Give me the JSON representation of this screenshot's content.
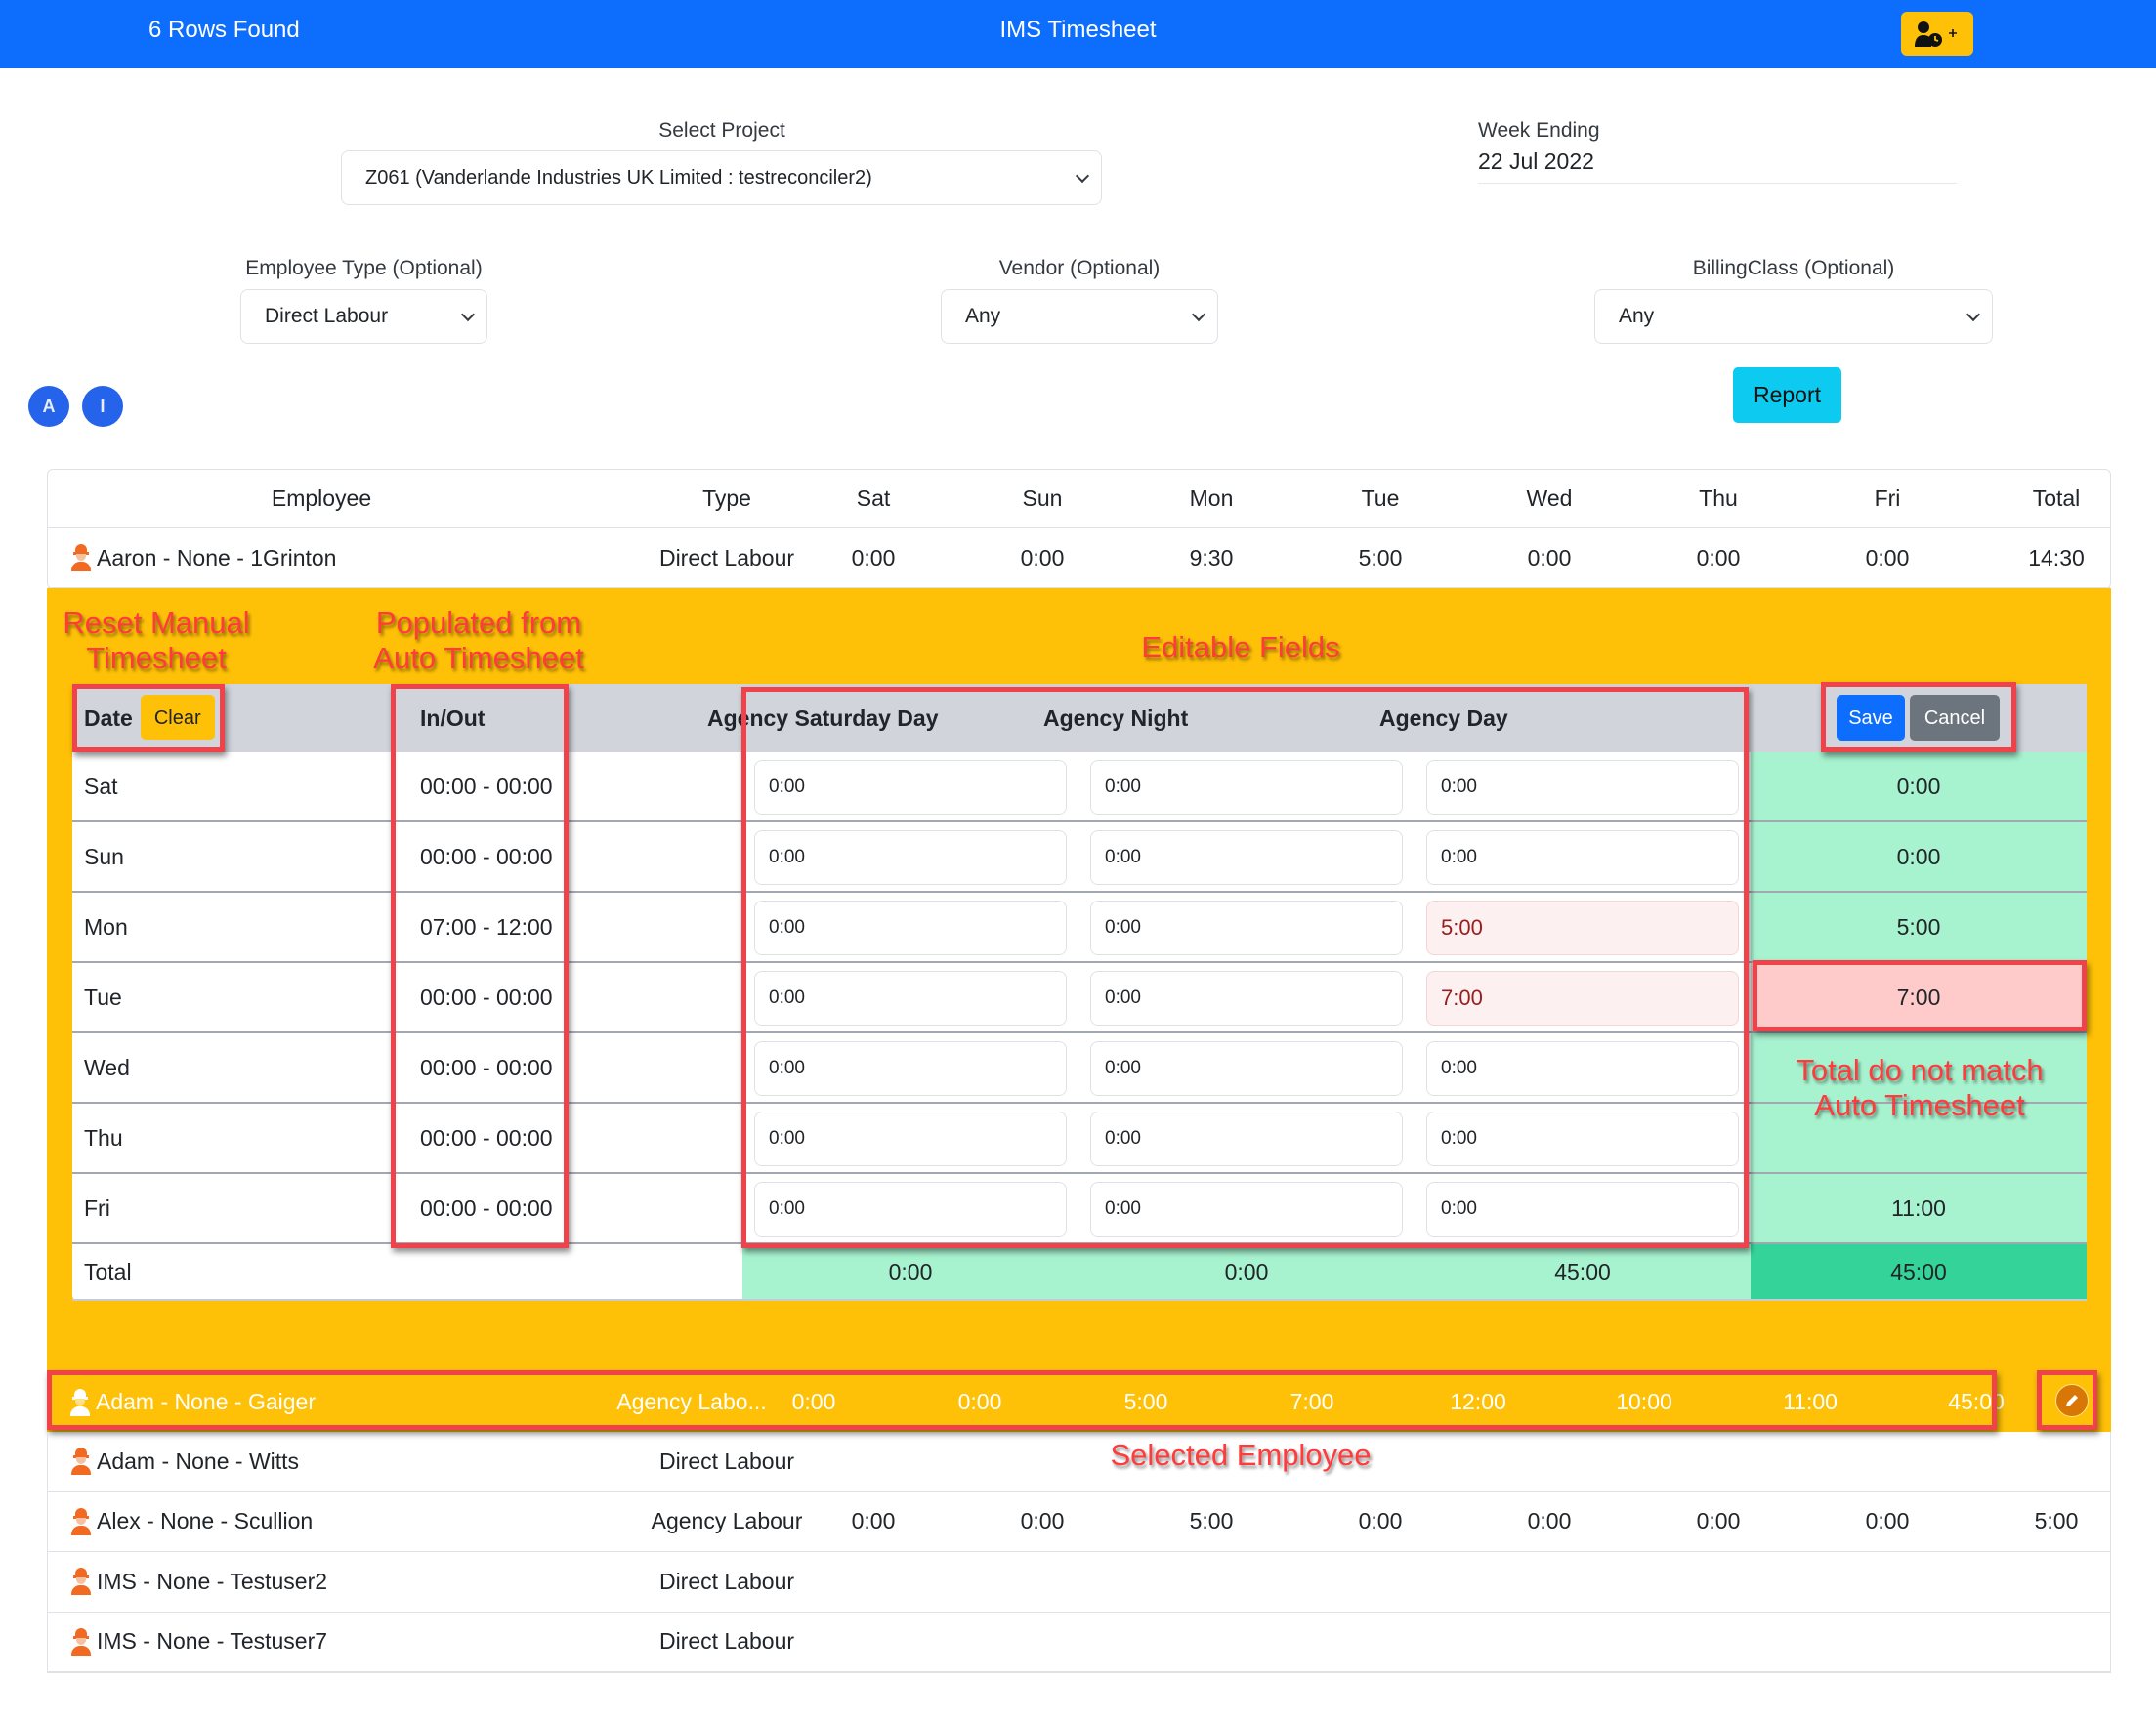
{
  "header": {
    "rows_found": "6 Rows Found",
    "title": "IMS Timesheet",
    "add_button_icon": "user-clock-plus-icon"
  },
  "filters": {
    "project_label": "Select Project",
    "project_value": "Z061 (Vanderlande Industries UK Limited : testreconciler2)",
    "week_ending_label": "Week Ending",
    "week_ending_value": "22 Jul 2022",
    "employee_type_label": "Employee Type (Optional)",
    "employee_type_value": "Direct Labour",
    "vendor_label": "Vendor (Optional)",
    "vendor_value": "Any",
    "billing_label": "BillingClass (Optional)",
    "billing_value": "Any",
    "report_button": "Report",
    "circle_a": "A",
    "circle_i": "I"
  },
  "table": {
    "columns": [
      "Employee",
      "Type",
      "Sat",
      "Sun",
      "Mon",
      "Tue",
      "Wed",
      "Thu",
      "Fri",
      "Total"
    ],
    "rows": [
      {
        "name": "Aaron - None - 1Grinton",
        "type": "Direct Labour",
        "values": [
          "0:00",
          "0:00",
          "9:30",
          "5:00",
          "0:00",
          "0:00",
          "0:00",
          "14:30"
        ]
      },
      {
        "name": "Adam - None - Gaiger",
        "type": "Agency Labo...",
        "values": [
          "0:00",
          "0:00",
          "5:00",
          "7:00",
          "12:00",
          "10:00",
          "11:00",
          "45:00"
        ],
        "selected": true
      },
      {
        "name": "Adam - None - Witts",
        "type": "Direct Labour",
        "values": [
          "",
          "",
          "",
          "",
          "",
          "",
          "",
          ""
        ]
      },
      {
        "name": "Alex - None - Scullion",
        "type": "Agency Labour",
        "values": [
          "0:00",
          "0:00",
          "5:00",
          "0:00",
          "0:00",
          "0:00",
          "0:00",
          "5:00"
        ]
      },
      {
        "name": "IMS - None - Testuser2",
        "type": "Direct Labour",
        "values": [
          "",
          "",
          "",
          "",
          "",
          "",
          "",
          ""
        ]
      },
      {
        "name": "IMS - None - Testuser7",
        "type": "Direct Labour",
        "values": [
          "",
          "",
          "",
          "",
          "",
          "",
          "",
          ""
        ]
      }
    ]
  },
  "editor": {
    "date_header": "Date",
    "clear_button": "Clear",
    "inout_header": "In/Out",
    "col_headers": [
      "Agency Saturday Day",
      "Agency Night",
      "Agency Day"
    ],
    "save_button": "Save",
    "cancel_button": "Cancel",
    "days": [
      {
        "day": "Sat",
        "inout": "00:00 - 00:00",
        "values": [
          "0:00",
          "0:00",
          "0:00"
        ],
        "total": "0:00"
      },
      {
        "day": "Sun",
        "inout": "00:00 - 00:00",
        "values": [
          "0:00",
          "0:00",
          "0:00"
        ],
        "total": "0:00"
      },
      {
        "day": "Mon",
        "inout": "07:00 - 12:00",
        "values": [
          "0:00",
          "0:00",
          "5:00"
        ],
        "total": "5:00"
      },
      {
        "day": "Tue",
        "inout": "00:00 - 00:00",
        "values": [
          "0:00",
          "0:00",
          "7:00"
        ],
        "total": "7:00"
      },
      {
        "day": "Wed",
        "inout": "00:00 - 00:00",
        "values": [
          "0:00",
          "0:00",
          "0:00"
        ],
        "total": ""
      },
      {
        "day": "Thu",
        "inout": "00:00 - 00:00",
        "values": [
          "0:00",
          "0:00",
          "0:00"
        ],
        "total": ""
      },
      {
        "day": "Fri",
        "inout": "00:00 - 00:00",
        "values": [
          "0:00",
          "0:00",
          "0:00"
        ],
        "total": "11:00"
      }
    ],
    "total_label": "Total",
    "col_totals": [
      "0:00",
      "0:00",
      "45:00"
    ],
    "grand_total": "45:00"
  },
  "annotations": {
    "reset": "Reset Manual Timesheet",
    "reset_line1": "Reset Manual",
    "reset_line2": "Timesheet",
    "populated_line1": "Populated from",
    "populated_line2": "Auto Timesheet",
    "editable": "Editable Fields",
    "mismatch_line1": "Total do not match",
    "mismatch_line2": "Auto Timesheet",
    "selected": "Selected Employee"
  },
  "colors": {
    "header_blue": "#0d6efd",
    "highlight_yellow": "#ffc107",
    "report_cyan": "#0dcaf0",
    "total_green": "#a7f3d0",
    "grand_total_green": "#34d399",
    "mismatch_red": "#fecaca",
    "annotation_red": "#ff3b3b"
  }
}
